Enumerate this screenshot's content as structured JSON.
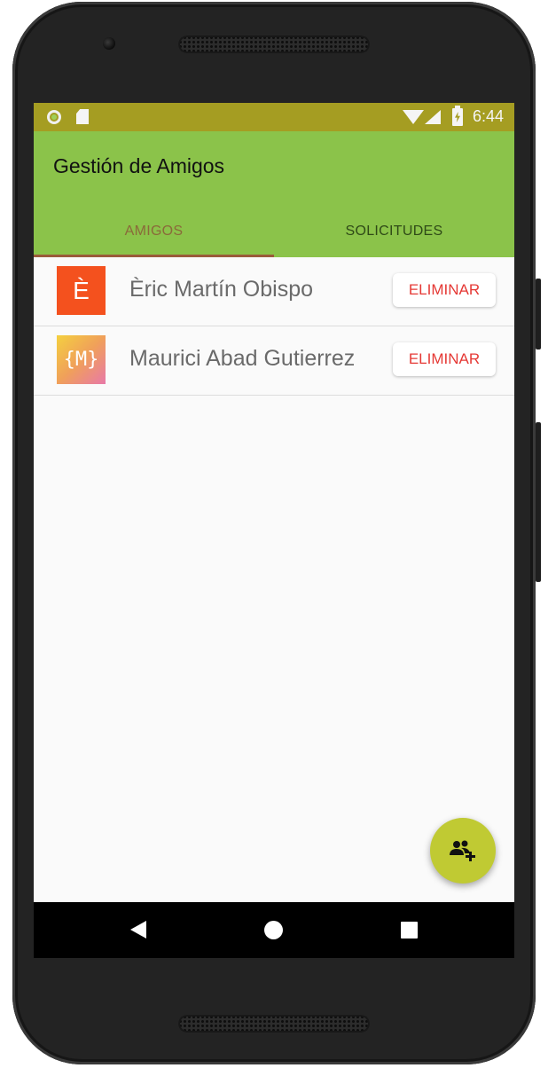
{
  "status_bar": {
    "time": "6:44"
  },
  "app": {
    "title": "Gestión de Amigos"
  },
  "tabs": [
    {
      "label": "AMIGOS",
      "selected": true
    },
    {
      "label": "SOLICITUDES",
      "selected": false
    }
  ],
  "friends": [
    {
      "avatar_text": "È",
      "name": "Èric Martín Obispo",
      "action_label": "ELIMINAR"
    },
    {
      "avatar_text": "{M}",
      "name": "Maurici Abad Gutierrez",
      "action_label": "ELIMINAR"
    }
  ],
  "fab": {
    "icon": "add-friend-icon"
  },
  "colors": {
    "status_bar": "#a59d22",
    "app_bar": "#8bc34a",
    "fab": "#c0ca33",
    "delete_text": "#e53935",
    "tab_indicator": "#9a5b3a"
  }
}
